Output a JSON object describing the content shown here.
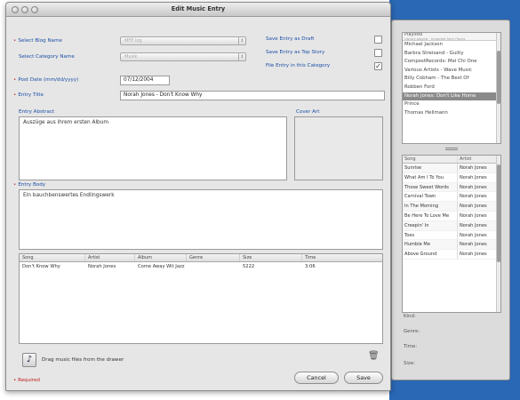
{
  "window": {
    "title": "Edit Music Entry"
  },
  "form": {
    "select_blog_name_label": "Select Blog Name",
    "blog_name_value": "MFE log",
    "select_category_label": "Select Category Name",
    "category_value": "Musik",
    "post_date_label": "Post Date (mm/dd/yyyy)",
    "post_date_value": "07/12/2004",
    "entry_title_label": "Entry Title",
    "entry_title_value": "Norah Jones - Don't Know Why",
    "entry_abstract_label": "Entry Abstract",
    "entry_abstract_value": "Auszüge aus ihrem ersten Album",
    "cover_art_label": "Cover Art",
    "entry_body_label": "Entry Body",
    "entry_body_value": "Ein bauchbenswertes Endlingswerk",
    "save_draft_label": "Save Entry as Draft",
    "save_top_label": "Save Entry as Top Story",
    "file_entry_label": "File Entry in this Category",
    "drag_hint": "Drag music files from the drawer",
    "required_label": "Required"
  },
  "song_table": {
    "headers": [
      "Song",
      "Artist",
      "Album",
      "Genre",
      "Size",
      "Time"
    ],
    "rows": [
      [
        "Don't Know Why",
        "Norah Jones",
        "Come Away Wit Jazz",
        "",
        "5222",
        "3:06"
      ]
    ]
  },
  "buttons": {
    "cancel": "Cancel",
    "save": "Save"
  },
  "drawer": {
    "playlist_header": "Playlists",
    "playlist_sub": "Library playlist · Imported from iTunes",
    "playlists": [
      "Michael Jackson",
      "Barbra Streisand - Guilty",
      "CompostRecords: Mei Chi One",
      "Various Artists - Wave Music",
      "Billy Cobham - The Best Of",
      "Robben Ford",
      "Norah Jones: Don't Like Home",
      "Prince",
      "Thomas Hellmann"
    ],
    "selected_index": 6,
    "song_headers": [
      "Song",
      "Artist"
    ],
    "songs": [
      [
        "Sunrise",
        "Norah Jones"
      ],
      [
        "What Am I To You",
        "Norah Jones"
      ],
      [
        "Those Sweet Words",
        "Norah Jones"
      ],
      [
        "Carnival Town",
        "Norah Jones"
      ],
      [
        "In The Morning",
        "Norah Jones"
      ],
      [
        "Be Here To Love Me",
        "Norah Jones"
      ],
      [
        "Creepin' In",
        "Norah Jones"
      ],
      [
        "Toes",
        "Norah Jones"
      ],
      [
        "Humble Me",
        "Norah Jones"
      ],
      [
        "Above Ground",
        "Norah Jones"
      ]
    ],
    "meta_labels": [
      "Kind:",
      "Genre:",
      "Time:",
      "Size:"
    ]
  },
  "colors": {
    "label_blue": "#1b4fa6",
    "required_red": "#c02020",
    "desktop_blue": "#2a67b4",
    "selection_gray": "#8a8a8a"
  }
}
